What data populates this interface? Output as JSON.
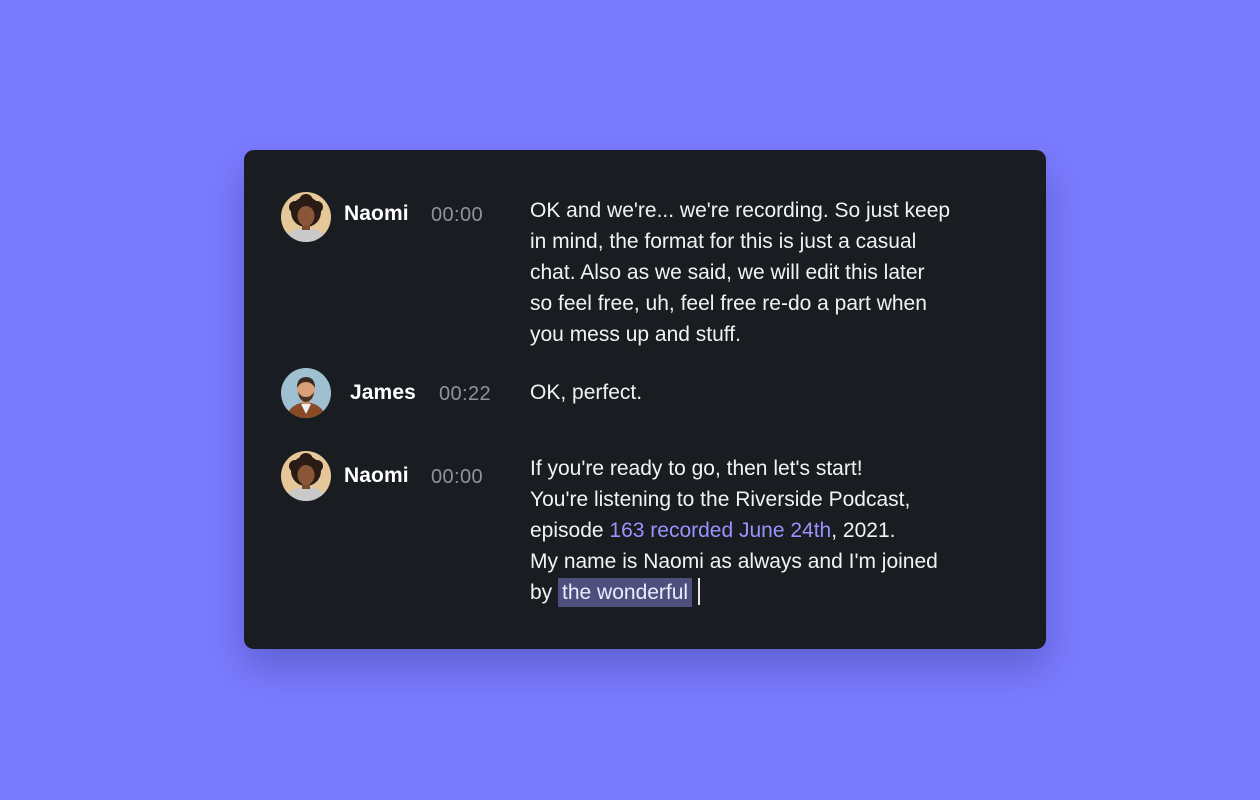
{
  "transcript": [
    {
      "speaker": "Naomi",
      "time": "00:00",
      "avatar_icon": "woman-curly-hair-avatar",
      "lines": [
        "OK and we're... we're recording. So just keep",
        "in mind, the format for this is just a casual",
        "chat. Also as we said, we will edit this later",
        "so feel free, uh, feel free re-do a part when",
        "you mess up and stuff."
      ]
    },
    {
      "speaker": "James",
      "time": "00:22",
      "avatar_icon": "man-beard-avatar",
      "lines": [
        "OK, perfect."
      ]
    },
    {
      "speaker": "Naomi",
      "time": "00:00",
      "avatar_icon": "woman-curly-hair-avatar",
      "line1": "If you're ready to go, then let's start!",
      "line2": "You're listening to the Riverside Podcast,",
      "line3_pre": "episode ",
      "line3_link": "163 recorded June 24th",
      "line3_post": ", 2021.",
      "line4": "My name is Naomi as always and I'm joined",
      "line5_pre": "by ",
      "line5_highlight": "the wonderful"
    }
  ],
  "colors": {
    "background": "#7b7bff",
    "card": "#191c20",
    "link": "#9a93ff",
    "highlight": "#4d4f7d",
    "timestamp": "#8f949b"
  }
}
